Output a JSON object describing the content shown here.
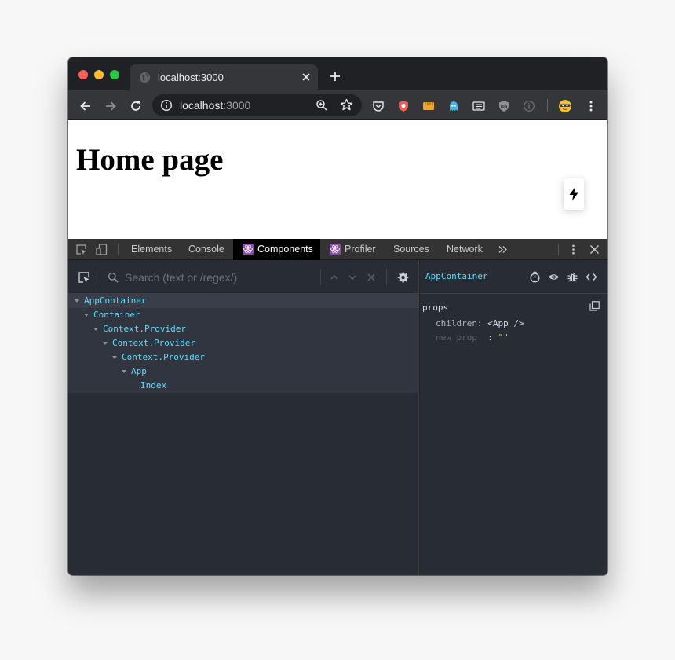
{
  "browser": {
    "tab_title": "localhost:3000",
    "url_host": "localhost",
    "url_port": ":3000"
  },
  "page": {
    "heading": "Home page"
  },
  "devtools": {
    "tabs": [
      {
        "label": "Elements"
      },
      {
        "label": "Console"
      },
      {
        "label": "Components"
      },
      {
        "label": "Profiler"
      },
      {
        "label": "Sources"
      },
      {
        "label": "Network"
      }
    ],
    "search_placeholder": "Search (text or /regex/)",
    "tree": [
      {
        "label": "AppContainer",
        "depth": 0,
        "expandable": true
      },
      {
        "label": "Container",
        "depth": 1,
        "expandable": true
      },
      {
        "label": "Context.Provider",
        "depth": 2,
        "expandable": true
      },
      {
        "label": "Context.Provider",
        "depth": 3,
        "expandable": true
      },
      {
        "label": "Context.Provider",
        "depth": 4,
        "expandable": true
      },
      {
        "label": "App",
        "depth": 5,
        "expandable": true
      },
      {
        "label": "Index",
        "depth": 6,
        "expandable": false
      }
    ],
    "selected_component": "AppContainer",
    "props_label": "props",
    "props": [
      {
        "key": "children",
        "value": "<App />"
      },
      {
        "key": "new prop",
        "value": "\"\""
      }
    ]
  },
  "colors": {
    "component_accent": "#61dafb",
    "active_tab_bg": "#000000",
    "react_badge": "#8a4baf"
  }
}
